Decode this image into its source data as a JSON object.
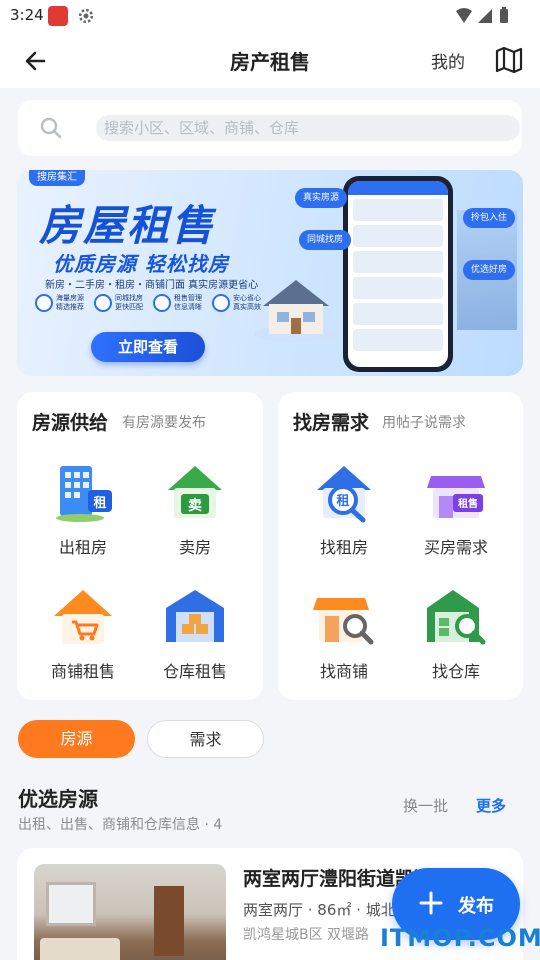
{
  "status_bar": {
    "time": "3:24",
    "app_badge": ""
  },
  "header": {
    "title": "房产租售",
    "mine_label": "我的",
    "back_icon": "arrow-left-icon",
    "map_icon": "map-icon"
  },
  "search": {
    "placeholder": "搜索小区、区域、商铺、仓库"
  },
  "banner": {
    "brand": "搜房集汇",
    "title": "房屋租售",
    "subtitle": "优质房源  轻松找房",
    "tags": "新房・二手房・租房・商铺门面  真实房源更省心",
    "features": [
      "海量房源 精选推荐",
      "同城找房 更快匹配",
      "租售管理 信息清晰",
      "安心省心 真实高效"
    ],
    "cta": "立即查看",
    "chips": [
      "真实房源",
      "同城找房",
      "拎包入住",
      "优选好房"
    ]
  },
  "supply_card": {
    "title": "房源供给",
    "subtitle": "有房源要发布",
    "items": [
      {
        "label": "出租房",
        "icon": "rental-building-icon"
      },
      {
        "label": "卖房",
        "icon": "sell-house-icon"
      },
      {
        "label": "商铺租售",
        "icon": "shop-cart-house-icon"
      },
      {
        "label": "仓库租售",
        "icon": "warehouse-icon"
      }
    ]
  },
  "demand_card": {
    "title": "找房需求",
    "subtitle": "用帖子说需求",
    "items": [
      {
        "label": "找租房",
        "icon": "find-rental-icon"
      },
      {
        "label": "买房需求",
        "icon": "buy-house-shop-icon"
      },
      {
        "label": "找商铺",
        "icon": "find-shop-icon"
      },
      {
        "label": "找仓库",
        "icon": "find-warehouse-icon"
      }
    ]
  },
  "tabs": {
    "active": "房源",
    "inactive": "需求"
  },
  "section": {
    "title": "优选房源",
    "subtitle": "出租、出售、商铺和仓库信息 · 4",
    "refresh": "换一批",
    "more": "更多"
  },
  "listing": {
    "title": "两室两厅澧阳街道凯鸿星",
    "meta": "两室两厅 · 86㎡ · 城北",
    "address": "凯鸿星城B区 双堰路"
  },
  "fab": {
    "label": "发布"
  },
  "watermark": "ITMOP.COM",
  "colors": {
    "accent": "#1f6ff1",
    "tab_active": "#ff7a1f",
    "background": "#f4f5f8"
  }
}
